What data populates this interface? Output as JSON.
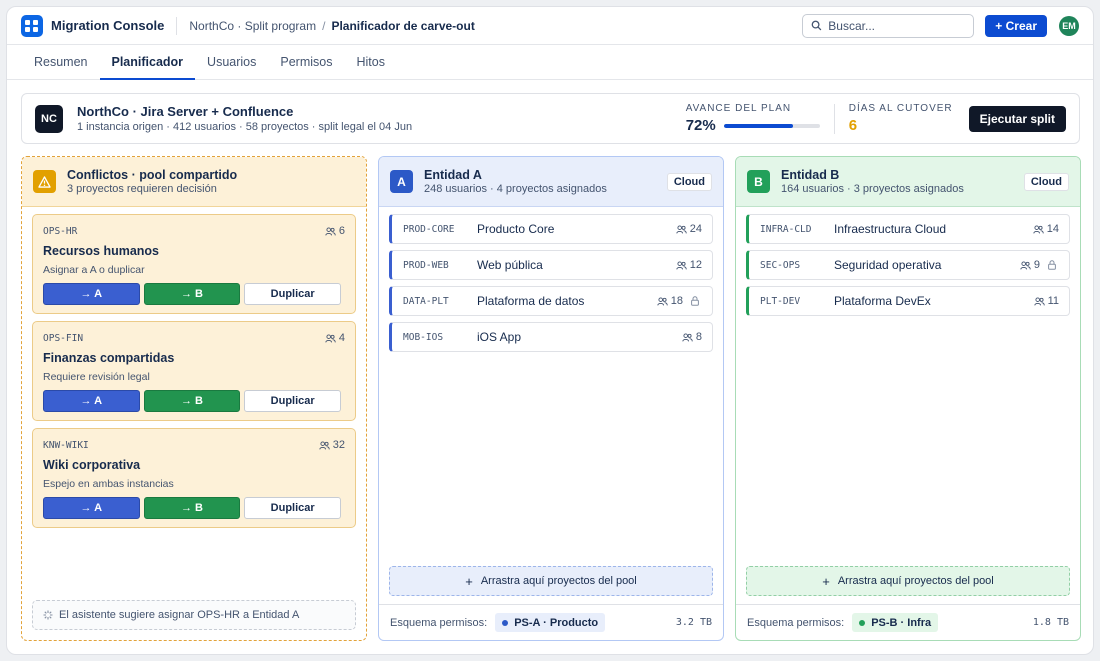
{
  "app": {
    "name": "Migration Console",
    "icon": "grid-logo-icon"
  },
  "breadcrumb": {
    "parent": "NorthCo · Split program",
    "separator": "/",
    "current": "Planificador de carve-out"
  },
  "search": {
    "placeholder": "Buscar..."
  },
  "create_label": "+ Crear",
  "user": {
    "initials": "EM"
  },
  "tabs": [
    {
      "label": "Resumen",
      "active": false
    },
    {
      "label": "Planificador",
      "active": true
    },
    {
      "label": "Usuarios",
      "active": false
    },
    {
      "label": "Permisos",
      "active": false
    },
    {
      "label": "Hitos",
      "active": false
    }
  ],
  "plan": {
    "badge": "NC",
    "title": "NorthCo · Jira Server + Confluence",
    "subtitle": "1 instancia origen · 412 usuarios · 58 proyectos · split legal el 04 Jun",
    "progress_label": "AVANCE DEL PLAN",
    "progress_value": "72%",
    "progress_fraction": 0.72,
    "days_label": "DÍAS AL CUTOVER",
    "days_value": "6",
    "run_label": "Ejecutar split"
  },
  "conflicts": {
    "icon": "warning-icon",
    "title": "Conflictos · pool compartido",
    "subtitle": "3 proyectos requieren decisión",
    "items": [
      {
        "code": "OPS-HR",
        "count": "6",
        "name": "Recursos humanos",
        "note": "Asignar a A o duplicar",
        "to_a": "→ A",
        "to_b": "→ B",
        "dup": "Duplicar"
      },
      {
        "code": "OPS-FIN",
        "count": "4",
        "name": "Finanzas compartidas",
        "note": "Requiere revisión legal",
        "to_a": "→ A",
        "to_b": "→ B",
        "dup": "Duplicar"
      },
      {
        "code": "KNW-WIKI",
        "count": "32",
        "name": "Wiki corporativa",
        "note": "Espejo en ambas instancias",
        "to_a": "→ A",
        "to_b": "→ B",
        "dup": "Duplicar"
      }
    ],
    "assistant": "El asistente sugiere asignar OPS-HR a Entidad A"
  },
  "entity_a": {
    "badge": "A",
    "title": "Entidad A",
    "subtitle": "248 usuarios · 4 proyectos asignados",
    "tag": "Cloud",
    "projects": [
      {
        "code": "PROD-CORE",
        "name": "Producto Core",
        "count": "24",
        "locked": false
      },
      {
        "code": "PROD-WEB",
        "name": "Web pública",
        "count": "12",
        "locked": false
      },
      {
        "code": "DATA-PLT",
        "name": "Plataforma de datos",
        "count": "18",
        "locked": true
      },
      {
        "code": "MOB-IOS",
        "name": "iOS App",
        "count": "8",
        "locked": false
      }
    ],
    "drop_label": "Arrastra aquí proyectos del pool",
    "scheme_label": "Esquema permisos:",
    "scheme": "PS-A · Producto",
    "size": "3.2 TB"
  },
  "entity_b": {
    "badge": "B",
    "title": "Entidad B",
    "subtitle": "164 usuarios · 3 proyectos asignados",
    "tag": "Cloud",
    "projects": [
      {
        "code": "INFRA-CLD",
        "name": "Infraestructura Cloud",
        "count": "14",
        "locked": false
      },
      {
        "code": "SEC-OPS",
        "name": "Seguridad operativa",
        "count": "9",
        "locked": true
      },
      {
        "code": "PLT-DEV",
        "name": "Plataforma DevEx",
        "count": "11",
        "locked": false
      }
    ],
    "drop_label": "Arrastra aquí proyectos del pool",
    "scheme_label": "Esquema permisos:",
    "scheme": "PS-B · Infra",
    "size": "1.8 TB"
  }
}
